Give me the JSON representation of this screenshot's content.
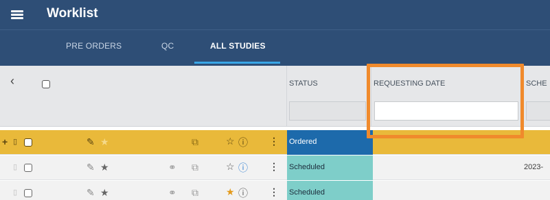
{
  "header": {
    "title": "Worklist",
    "menu_icon": "hamburger-menu-icon"
  },
  "tabs": [
    {
      "label": "PRE ORDERS",
      "active": false
    },
    {
      "label": "QC",
      "active": false
    },
    {
      "label": "ALL STUDIES",
      "active": true
    }
  ],
  "grid": {
    "columns": {
      "status": "STATUS",
      "requesting_date": "REQUESTING DATE",
      "scheduled_truncated": "SCHE"
    },
    "filters": {
      "status_value": "",
      "requesting_date_value": ""
    },
    "rows": [
      {
        "status": "Ordered",
        "date": "",
        "selected": true,
        "status_color": "#1d6aab"
      },
      {
        "status": "Scheduled",
        "date": "2023-",
        "selected": false,
        "status_color": "#7ecec9"
      },
      {
        "status": "Scheduled",
        "date": "",
        "selected": false,
        "status_color": "#7ecec9"
      }
    ]
  },
  "colors": {
    "header_bg": "#2e4e76",
    "selected_row": "#e9b93a",
    "highlight": "#f08a2c",
    "tab_indicator": "#39a6e6"
  }
}
